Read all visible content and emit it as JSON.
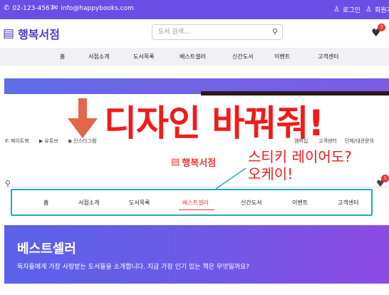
{
  "topbar": {
    "phone": "02-123-4567",
    "email": "info@happybooks.com",
    "login": "로그인",
    "signup": "회원가",
    "phone_icon": "phone-icon",
    "email_icon": "envelope-icon"
  },
  "header": {
    "logo": "행복서점",
    "search_placeholder": "도서 검색...",
    "cart_count": "3"
  },
  "nav": {
    "items": [
      "홈",
      "서점소개",
      "도서목록",
      "베스트셀러",
      "신간도서",
      "이벤트",
      "고객센터"
    ]
  },
  "annotation": {
    "main": "디자인 바꿔줘!",
    "line1": "스티키 레이어도?",
    "line2": "오케이!"
  },
  "social": {
    "items": [
      "페이트북",
      "유튜브",
      "인스타그램"
    ]
  },
  "util_links": {
    "items": [
      "멤버십",
      "고객센터",
      "단체/대관문의"
    ]
  },
  "sticky": {
    "logo": "행복서점",
    "cart_count": "3",
    "items": [
      "홈",
      "서점소개",
      "도서목록",
      "베스트셀러",
      "신간도서",
      "이벤트",
      "고객센터"
    ],
    "active": "베스트셀러"
  },
  "banner": {
    "title": "베스트셀러",
    "subtitle": "독자들에게 가장 사랑받는 도서들을 소개합니다. 지금 가장 인기 있는 책은 무엇일까요?"
  },
  "colors": {
    "primary": "#6a4ee6",
    "annotation": "#f11b1b",
    "highlight": "#26a7c8",
    "arrow": "#e2674a"
  }
}
